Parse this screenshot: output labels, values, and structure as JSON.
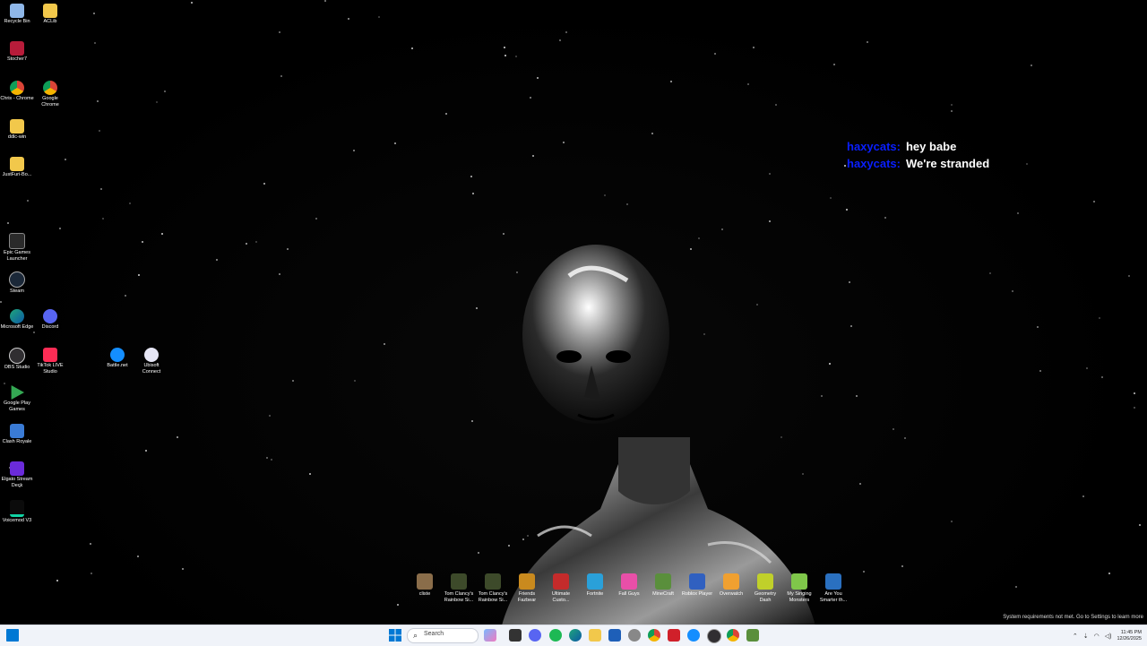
{
  "desktop": {
    "icons": [
      {
        "label": "Recycle Bin",
        "icon": "recycle-bin-icon",
        "color": "#8fb7e8"
      },
      {
        "label": "ACLib",
        "icon": "folder-icon",
        "color": "#f2c84b"
      },
      {
        "label": "Stocher7",
        "icon": "app-icon",
        "color": "#b71c3a"
      },
      {
        "label": "Chris - Chrome",
        "icon": "chrome-icon",
        "color": "#db4437"
      },
      {
        "label": "Google Chrome",
        "icon": "chrome-icon",
        "color": "#db4437"
      },
      {
        "label": "ddlc-win",
        "icon": "folder-icon",
        "color": "#f2c84b"
      },
      {
        "label": "JustFuri-Bo...",
        "icon": "folder-icon",
        "color": "#f2c84b"
      },
      {
        "label": "Epic Games Launcher",
        "icon": "epic-icon",
        "color": "#2a2a2a"
      },
      {
        "label": "Steam",
        "icon": "steam-icon",
        "color": "#1b2838"
      },
      {
        "label": "Microsoft Edge",
        "icon": "edge-icon",
        "color": "#1fa67a"
      },
      {
        "label": "Discord",
        "icon": "discord-icon",
        "color": "#5865f2"
      },
      {
        "label": "Battle.net",
        "icon": "battlenet-icon",
        "color": "#148eff"
      },
      {
        "label": "Ubisoft Connect",
        "icon": "ubisoft-icon",
        "color": "#e6e6f5"
      },
      {
        "label": "OBS Studio",
        "icon": "obs-icon",
        "color": "#302e31"
      },
      {
        "label": "TikTok LIVE Studio",
        "icon": "tiktok-icon",
        "color": "#fe2c55"
      },
      {
        "label": "Google Play Games",
        "icon": "play-games-icon",
        "color": "#34a853"
      },
      {
        "label": "Clash Royale",
        "icon": "clash-royale-icon",
        "color": "#3a7bd5"
      },
      {
        "label": "Elgato Stream Deck",
        "icon": "stream-deck-icon",
        "color": "#6a2bd9"
      },
      {
        "label": "Voicemod V3",
        "icon": "voicemod-icon",
        "color": "#11d3a4"
      }
    ],
    "dock": [
      {
        "label": "cliste",
        "color": "#8a6d4a"
      },
      {
        "label": "Tom Clancy's Rainbow Si...",
        "color": "#3d4a2a"
      },
      {
        "label": "Tom Clancy's Rainbow Si...",
        "color": "#3d4a2a"
      },
      {
        "label": "Friends Fazbear",
        "color": "#c98a1e"
      },
      {
        "label": "Ultimate Custo...",
        "color": "#c42b2b"
      },
      {
        "label": "Fortnite",
        "color": "#2aa0d9"
      },
      {
        "label": "Fall Guys",
        "color": "#e84fa8"
      },
      {
        "label": "MineCraft",
        "color": "#5a8f3c"
      },
      {
        "label": "Roblox Player",
        "color": "#3060c0"
      },
      {
        "label": "Overwatch",
        "color": "#f0a030"
      },
      {
        "label": "Geometry Dash",
        "color": "#c0d02a"
      },
      {
        "label": "My Singing Monsters",
        "color": "#7fc74a"
      },
      {
        "label": "Are You Smarter th...",
        "color": "#2a70c0"
      }
    ],
    "system_requirements": "System requirements not met. Go to Settings to learn more"
  },
  "chat": {
    "messages": [
      {
        "user": "haxycats:",
        "text": "hey babe"
      },
      {
        "user": "haxycats:",
        "text": "We're stranded"
      }
    ]
  },
  "taskbar": {
    "search_placeholder": "Search",
    "time": "11:45 PM",
    "date": "12/26/2025",
    "colors": {
      "start": "#0078d4",
      "accent": "#1d8a3a"
    }
  }
}
